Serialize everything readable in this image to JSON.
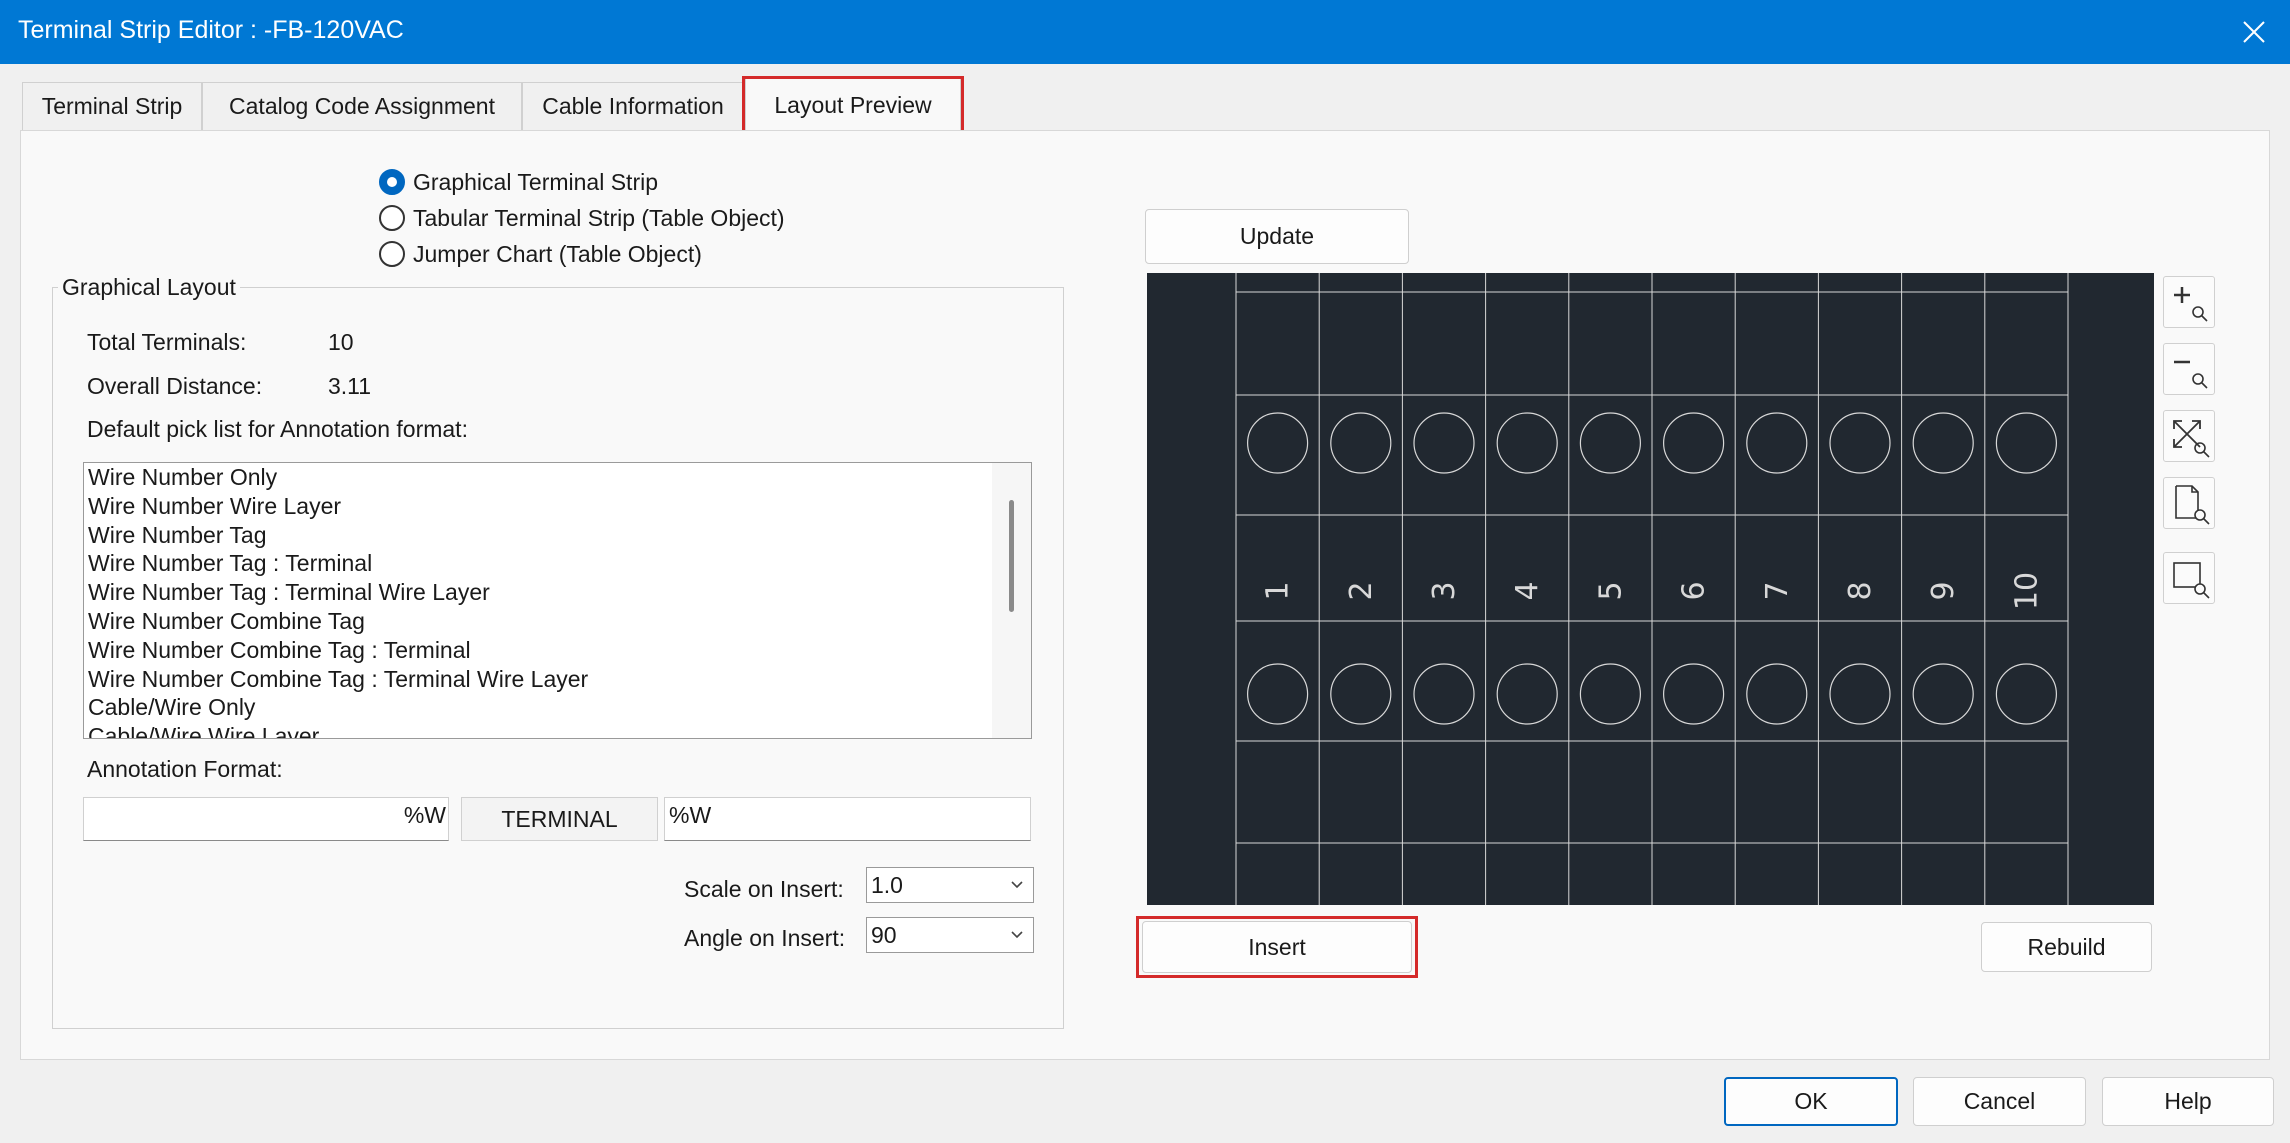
{
  "window": {
    "title": "Terminal Strip Editor : -FB-120VAC"
  },
  "tabs": [
    {
      "label": "Terminal Strip"
    },
    {
      "label": "Catalog Code Assignment"
    },
    {
      "label": "Cable Information"
    },
    {
      "label": "Layout Preview",
      "active": true
    }
  ],
  "output_options": [
    {
      "label": "Graphical Terminal Strip",
      "checked": true
    },
    {
      "label": "Tabular Terminal Strip (Table Object)",
      "checked": false
    },
    {
      "label": "Jumper Chart (Table Object)",
      "checked": false
    }
  ],
  "graphical_layout": {
    "legend": "Graphical Layout",
    "total_terminals_label": "Total Terminals:",
    "total_terminals_value": "10",
    "overall_distance_label": "Overall Distance:",
    "overall_distance_value": "3.11",
    "pick_list_label": "Default pick list for Annotation format:",
    "pick_list": [
      "Wire Number Only",
      "Wire Number Wire Layer",
      "Wire Number Tag",
      "Wire Number Tag : Terminal",
      "Wire Number Tag : Terminal Wire Layer",
      "Wire Number Combine Tag",
      "Wire Number Combine Tag : Terminal",
      "Wire Number Combine Tag : Terminal Wire Layer",
      "Cable/Wire Only",
      "Cable/Wire Wire Layer"
    ],
    "annotation_format_label": "Annotation Format:",
    "annotation_left": "%W",
    "annotation_center": "TERMINAL",
    "annotation_right": "%W",
    "scale_label": "Scale on Insert:",
    "scale_value": "1.0",
    "angle_label": "Angle on Insert:",
    "angle_value": "90"
  },
  "preview": {
    "update_label": "Update",
    "insert_label": "Insert",
    "rebuild_label": "Rebuild",
    "terminals": [
      "1",
      "2",
      "3",
      "4",
      "5",
      "6",
      "7",
      "8",
      "9",
      "10"
    ],
    "background_color": "#212830",
    "tools": [
      "zoom-in-icon",
      "zoom-out-icon",
      "zoom-extents-icon",
      "zoom-page-icon",
      "zoom-window-icon"
    ]
  },
  "footer": {
    "ok_label": "OK",
    "cancel_label": "Cancel",
    "help_label": "Help"
  },
  "colors": {
    "titlebar": "#0078d4",
    "highlight": "#d42a2a",
    "accent": "#0067c0"
  }
}
